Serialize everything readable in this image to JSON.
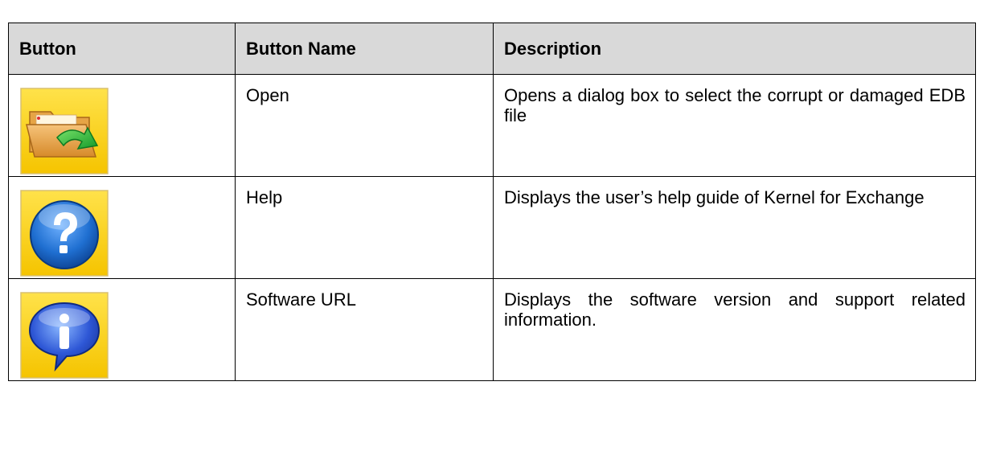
{
  "table": {
    "headers": {
      "button": "Button",
      "button_name": "Button Name",
      "description": "Description"
    },
    "rows": [
      {
        "icon": "open-folder-icon",
        "name": "Open",
        "description": "Opens a dialog box to select the corrupt or damaged EDB file"
      },
      {
        "icon": "help-question-icon",
        "name": "Help",
        "description": "Displays the user’s help guide of Kernel for Exchange"
      },
      {
        "icon": "info-speech-icon",
        "name": "Software URL",
        "description": "Displays the software version and support related information."
      }
    ]
  },
  "colors": {
    "header_background": "#d9d9d9",
    "icon_background": "#ffd400",
    "help_icon_blue": "#1f6fd1",
    "info_icon_blue": "#2e57d6",
    "open_arrow_green": "#27a834"
  }
}
